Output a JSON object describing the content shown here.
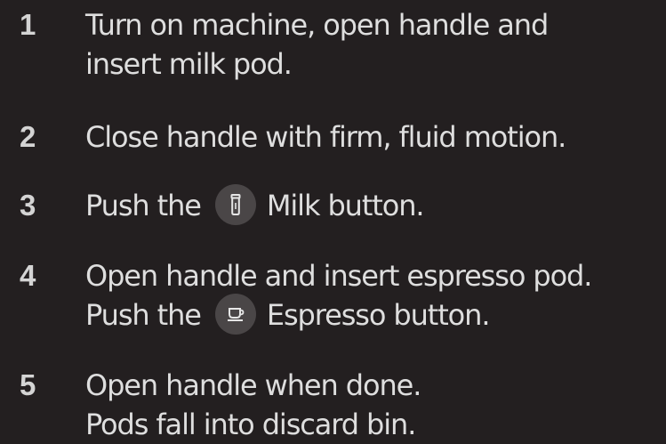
{
  "steps": [
    {
      "number": "1",
      "line1": "Turn on machine, open handle and",
      "line2": "insert milk pod."
    },
    {
      "number": "2",
      "line1": "Close handle with firm, fluid motion."
    },
    {
      "number": "3",
      "before": "Push the",
      "icon": "milk-bottle-icon",
      "after": "Milk button."
    },
    {
      "number": "4",
      "line1": "Open handle and insert espresso pod.",
      "before": "Push the",
      "icon": "espresso-cup-icon",
      "after": "Espresso button."
    },
    {
      "number": "5",
      "line1": "Open handle when done.",
      "line2": "Pods fall into discard bin."
    }
  ],
  "colors": {
    "background": "#231f20",
    "text": "#dedede",
    "icon_badge": "#4a4647",
    "icon_stroke": "#e6e6e6"
  }
}
